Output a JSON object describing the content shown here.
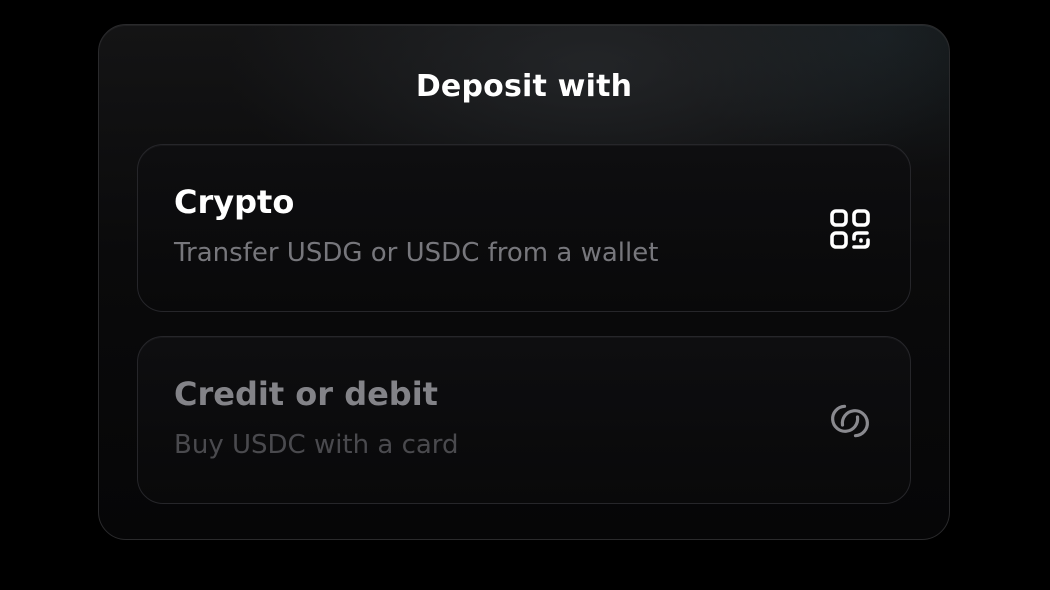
{
  "dialog": {
    "title": "Deposit with",
    "options": [
      {
        "title": "Crypto",
        "subtitle": "Transfer USDG or USDC from a wallet",
        "icon": "qr-code-icon"
      },
      {
        "title": "Credit or debit",
        "subtitle": "Buy USDC with a card",
        "icon": "card-rings-icon"
      }
    ]
  },
  "colors": {
    "background": "#000000",
    "panel": "#0b0b0c",
    "title_text": "#ffffff",
    "subtitle_text": "#77777c",
    "muted_title": "#838388",
    "muted_subtitle": "#4a4a4e"
  }
}
